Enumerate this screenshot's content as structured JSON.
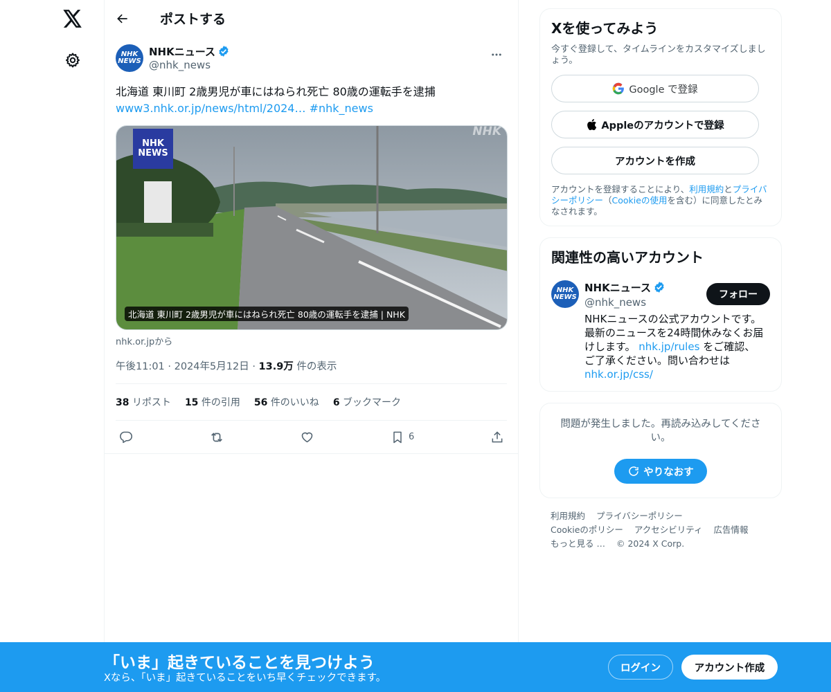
{
  "header": {
    "title": "ポストする"
  },
  "tweet": {
    "author_name": "NHKニュース",
    "author_handle": "@nhk_news",
    "avatar_text_line1": "NHK",
    "avatar_text_line2": "NEWS",
    "text": "北海道 東川町 2歳男児が車にはねられ死亡 80歳の運転手を逮捕",
    "link": "www3.nhk.or.jp/news/html/2024…",
    "hashtag": "#nhk_news",
    "media_caption": "北海道 東川町 2歳男児が車にはねられ死亡 80歳の運転手を逮捕 | NHK",
    "media_logo_line1": "NHK",
    "media_logo_line2": "NEWS",
    "media_watermark": "NHK",
    "source": "nhk.or.jpから",
    "time": "午後11:01",
    "date": "2024年5月12日",
    "views_count": "13.9万",
    "views_label": "件の表示",
    "stats": {
      "reposts_count": "38",
      "reposts_label": "リポスト",
      "quotes_count": "15",
      "quotes_label": "件の引用",
      "likes_count": "56",
      "likes_label": "件のいいね",
      "bookmarks_count": "6",
      "bookmarks_label": "ブックマーク"
    },
    "bookmark_action_count": "6"
  },
  "signup_card": {
    "title": "Xを使ってみよう",
    "subtitle": "今すぐ登録して、タイムラインをカスタマイズしましょう。",
    "google_label": "Google で登録",
    "apple_label": "Appleのアカウントで登録",
    "create_label": "アカウントを作成",
    "legal_prefix": "アカウントを登録することにより、",
    "terms": "利用規約",
    "and": "と",
    "privacy": "プライバシーポリシー",
    "paren_open": "（",
    "cookie": "Cookieの使用",
    "paren_close": "を含む）に同意したとみなされます。"
  },
  "related": {
    "title": "関連性の高いアカウント",
    "name": "NHKニュース",
    "handle": "@nhk_news",
    "follow_label": "フォロー",
    "bio_part1": "NHKニュースの公式アカウントです。最新のニュースを24時間休みなくお届けします。",
    "bio_link1": "nhk.jp/rules",
    "bio_part2": "をご確認、ご了承ください。問い合わせは",
    "bio_link2": "nhk.or.jp/css/"
  },
  "error_card": {
    "text": "問題が発生しました。再読み込みしてください。",
    "retry_label": "やりなおす"
  },
  "footer": {
    "links": [
      "利用規約",
      "プライバシーポリシー",
      "Cookieのポリシー",
      "アクセシビリティ",
      "広告情報",
      "もっと見る …",
      "© 2024 X Corp."
    ]
  },
  "banner": {
    "title": "「いま」起きていることを見つけよう",
    "subtitle": "Xなら、「いま」起きていることをいち早くチェックできます。",
    "login_label": "ログイン",
    "signup_label": "アカウント作成"
  },
  "colors": {
    "accent": "#1d9bf0",
    "text": "#0f1419",
    "muted": "#536471",
    "nhk_blue": "#1c5fb8"
  }
}
